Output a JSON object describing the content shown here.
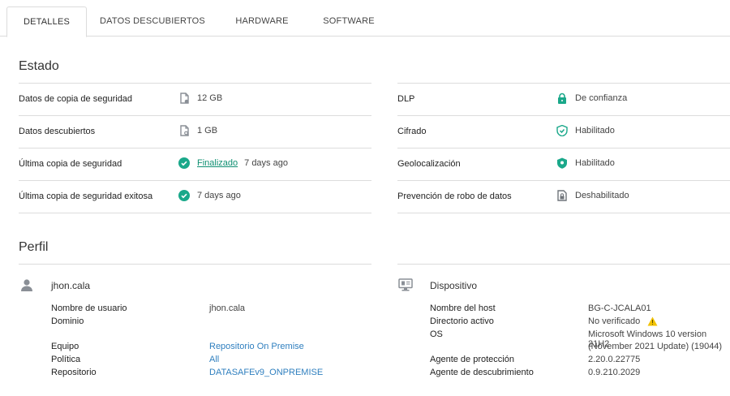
{
  "tabs": [
    {
      "label": "DETALLES",
      "active": true
    },
    {
      "label": "DATOS DESCUBIERTOS",
      "active": false
    },
    {
      "label": "HARDWARE",
      "active": false
    },
    {
      "label": "SOFTWARE",
      "active": false
    }
  ],
  "estado": {
    "title": "Estado",
    "left": [
      {
        "label": "Datos de copia de seguridad",
        "icon": "file-backup-icon",
        "value": "12 GB"
      },
      {
        "label": "Datos descubiertos",
        "icon": "file-search-icon",
        "value": "1 GB"
      },
      {
        "label": "Última copia de seguridad",
        "icon": "check-circle-icon",
        "link": "Finalizado",
        "value": "7 days ago"
      },
      {
        "label": "Última copia de seguridad exitosa",
        "icon": "check-circle-icon",
        "value": "7 days ago"
      }
    ],
    "right": [
      {
        "label": "DLP",
        "icon": "lock-icon",
        "value": "De confianza"
      },
      {
        "label": "Cifrado",
        "icon": "shield-check-icon",
        "value": "Habilitado"
      },
      {
        "label": "Geolocalización",
        "icon": "location-shield-icon",
        "value": "Habilitado"
      },
      {
        "label": "Prevención de robo de datos",
        "icon": "file-lock-icon",
        "value": "Deshabilitado"
      }
    ]
  },
  "perfil": {
    "title": "Perfil",
    "user": {
      "icon": "user-icon",
      "name": "jhon.cala",
      "fields": [
        {
          "label": "Nombre de usuario",
          "value": "jhon.cala"
        },
        {
          "label": "Dominio",
          "value": ""
        },
        {
          "label": "Equipo",
          "value": "Repositorio On Premise"
        },
        {
          "label": "Política",
          "value": "All"
        },
        {
          "label": "Repositorio",
          "value": "DATASAFEv9_ONPREMISE"
        }
      ]
    },
    "device": {
      "icon": "monitor-icon",
      "title": "Dispositivo",
      "fields": [
        {
          "label": "Nombre del host",
          "value": "BG-C-JCALA01"
        },
        {
          "label": "Directorio activo",
          "value": "No verificado",
          "icon": "warning-icon"
        },
        {
          "label": "OS",
          "value": "Microsoft Windows 10 version 21H2",
          "value2": "(November 2021 Update) (19044)"
        },
        {
          "label": "Agente de protección",
          "value": "2.20.0.22775"
        },
        {
          "label": "Agente de descubrimiento",
          "value": "0.9.210.2029"
        }
      ]
    }
  },
  "colors": {
    "accent_green": "#1aa88a",
    "link_blue": "#2f7fbf",
    "warning": "#f2c200",
    "icon_gray": "#8a8f96"
  }
}
